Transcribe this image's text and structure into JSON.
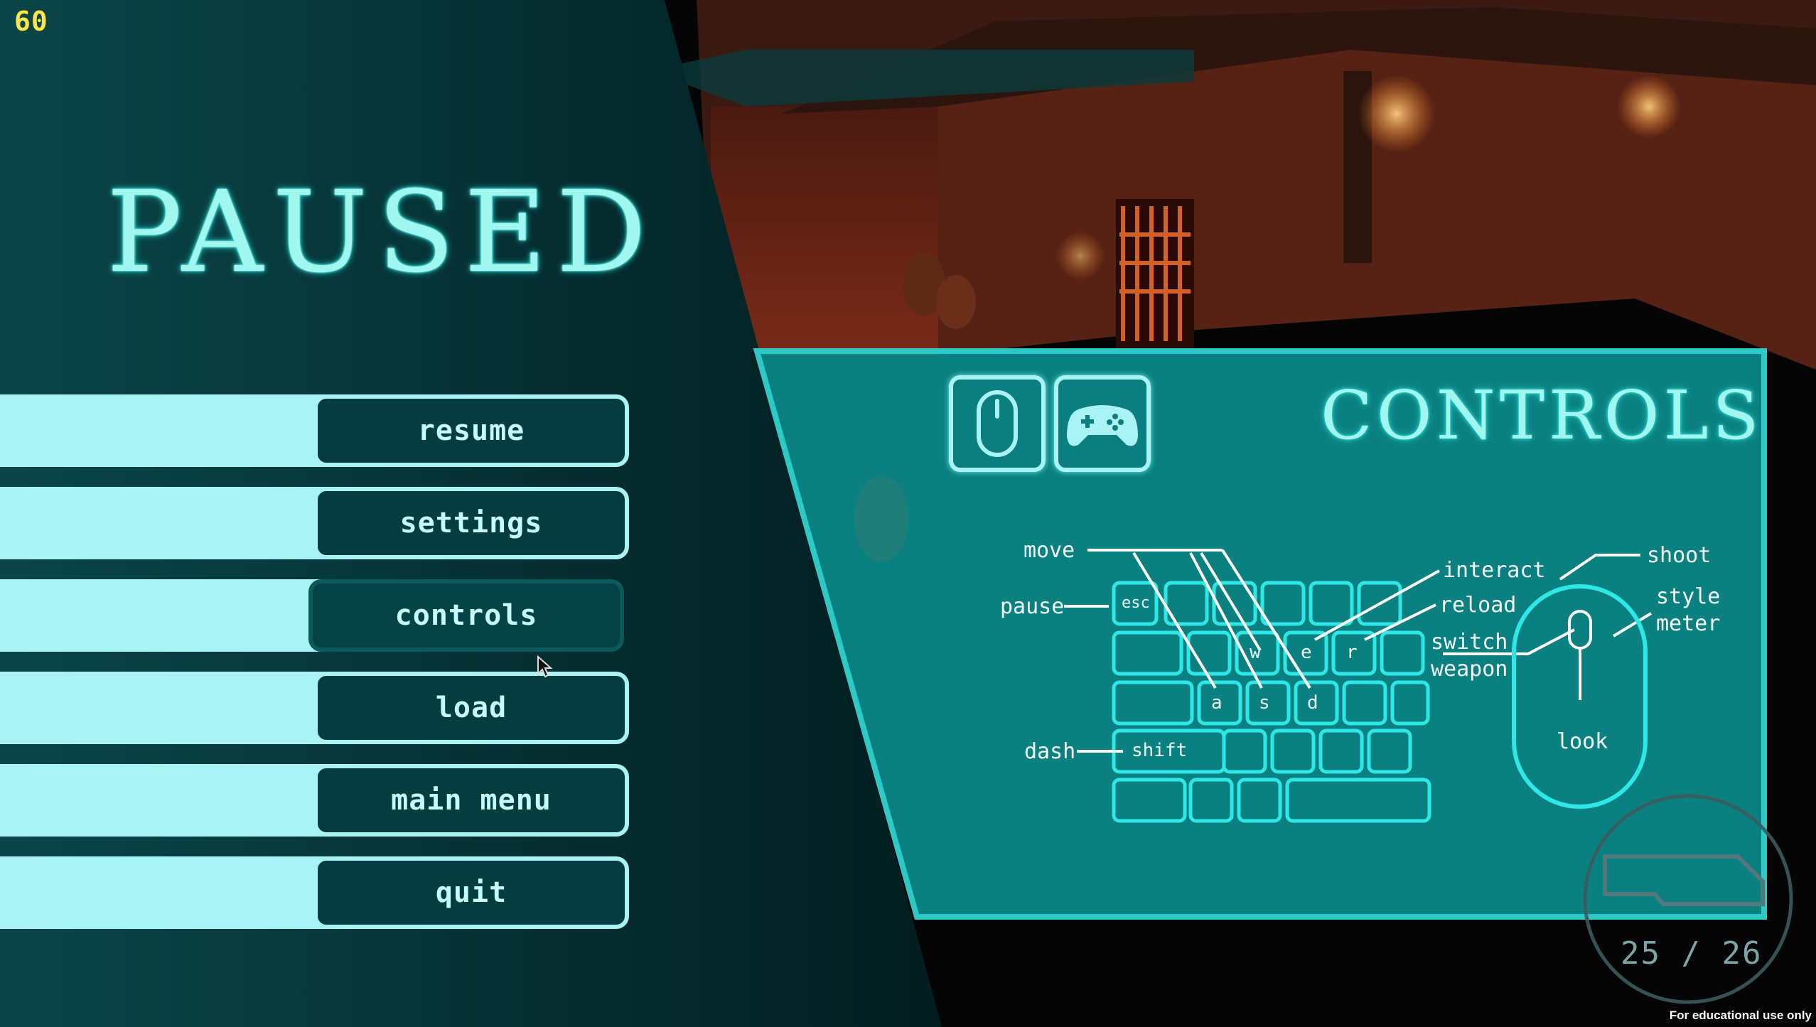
{
  "hud": {
    "fps": "60",
    "ammo": "25 / 26"
  },
  "pause_menu": {
    "title": "PAUSED",
    "buttons": [
      {
        "label": "resume"
      },
      {
        "label": "settings"
      },
      {
        "label": "controls"
      },
      {
        "label": "load"
      },
      {
        "label": "main menu"
      },
      {
        "label": "quit"
      }
    ],
    "selected": "controls"
  },
  "controls_panel": {
    "title": "CONTROLS",
    "device_tabs": [
      {
        "icon": "mouse-icon"
      },
      {
        "icon": "gamepad-icon"
      }
    ],
    "keyboard_labels": {
      "move": "move",
      "pause": "pause",
      "dash": "dash",
      "interact": "interact",
      "reload": "reload",
      "switch_weapon_line1": "switch",
      "switch_weapon_line2": "weapon"
    },
    "keys": {
      "esc": "esc",
      "w": "w",
      "e": "e",
      "r": "r",
      "a": "a",
      "s": "s",
      "d": "d",
      "shift": "shift"
    },
    "mouse_labels": {
      "shoot": "shoot",
      "style_line1": "style",
      "style_line2": "meter",
      "look": "look"
    }
  },
  "footer": {
    "notice": "For educational use only"
  },
  "colors": {
    "accent": "#a9f3f4",
    "panel": "#0c8a8b",
    "menu_bg": "#053c3f",
    "fps": "#ffe54a"
  }
}
